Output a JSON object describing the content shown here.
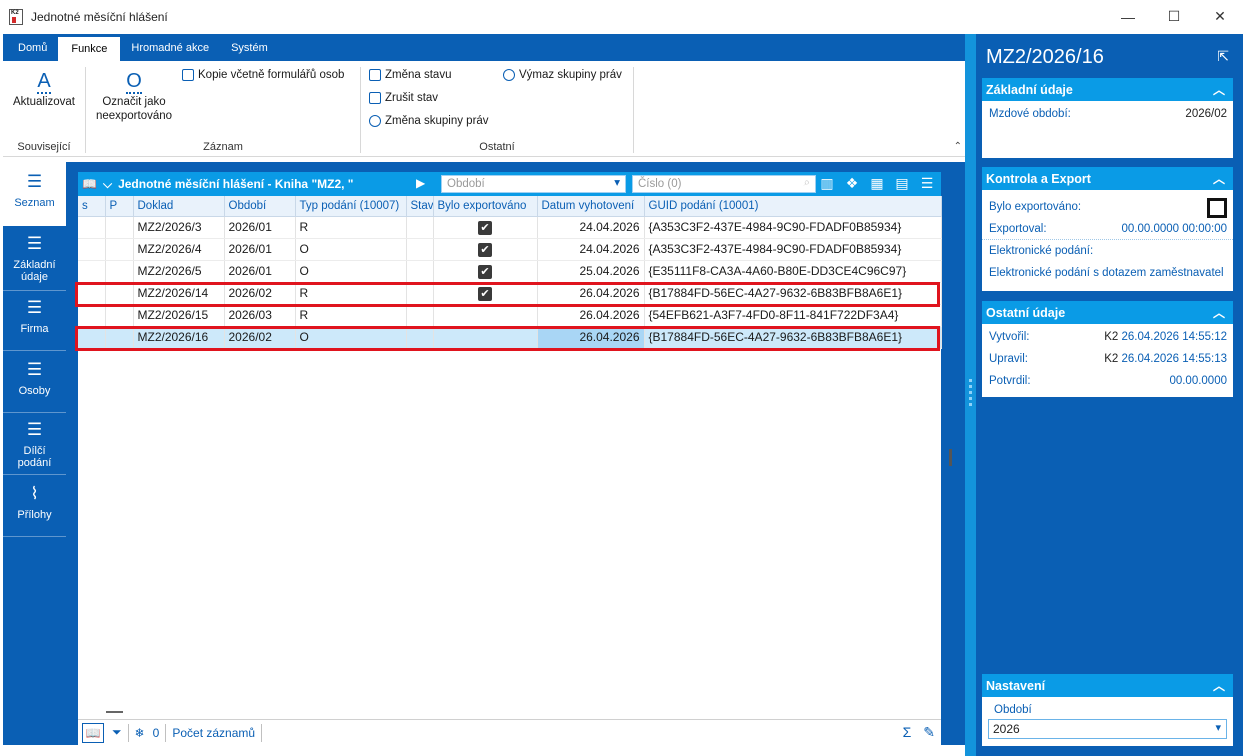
{
  "window": {
    "title": "Jednotné měsíční hlášení",
    "icon_text": "K2"
  },
  "ribbon": {
    "tabs": [
      "Domů",
      "Funkce",
      "Hromadné akce",
      "Systém"
    ],
    "active_tab": "Funkce",
    "groups": {
      "related": {
        "label": "Související",
        "refresh_label": "Aktualizovat"
      },
      "record": {
        "label": "Záznam",
        "mark_label_1": "Označit jako",
        "mark_label_2": "neexportováno",
        "copy_label": "Kopie včetně formulářů osob"
      },
      "other": {
        "label": "Ostatní",
        "change_state": "Změna stavu",
        "cancel_state": "Zrušit stav",
        "change_rights": "Změna skupiny práv",
        "delete_rights": "Výmaz skupiny práv"
      }
    }
  },
  "leftnav": {
    "items": [
      {
        "label": "Seznam"
      },
      {
        "label1": "Základní",
        "label2": "údaje"
      },
      {
        "label": "Firma"
      },
      {
        "label": "Osoby"
      },
      {
        "label1": "Dílčí",
        "label2": "podání"
      },
      {
        "label": "Přílohy"
      }
    ]
  },
  "grid": {
    "title": "Jednotné měsíční hlášení - Kniha \"MZ2, \"",
    "filter_period_placeholder": "Období",
    "filter_number_placeholder": "Číslo (0)",
    "columns": [
      "s",
      "P",
      "Doklad",
      "Období",
      "Typ podání (10007)",
      "Stav",
      "Bylo exportováno",
      "Datum vyhotovení",
      "GUID podání (10001)"
    ],
    "rows": [
      {
        "doklad": "MZ2/2026/3",
        "obdobi": "2026/01",
        "typ": "R",
        "exported": true,
        "datum": "24.04.2026",
        "guid": "{A353C3F2-437E-4984-9C90-FDADF0B85934}"
      },
      {
        "doklad": "MZ2/2026/4",
        "obdobi": "2026/01",
        "typ": "O",
        "exported": true,
        "datum": "24.04.2026",
        "guid": "{A353C3F2-437E-4984-9C90-FDADF0B85934}"
      },
      {
        "doklad": "MZ2/2026/5",
        "obdobi": "2026/01",
        "typ": "O",
        "exported": true,
        "datum": "25.04.2026",
        "guid": "{E35111F8-CA3A-4A60-B80E-DD3CE4C96C97}"
      },
      {
        "doklad": "MZ2/2026/14",
        "obdobi": "2026/02",
        "typ": "R",
        "exported": true,
        "datum": "26.04.2026",
        "guid": "{B17884FD-56EC-4A27-9632-6B83BFB8A6E1}"
      },
      {
        "doklad": "MZ2/2026/15",
        "obdobi": "2026/03",
        "typ": "R",
        "exported": false,
        "datum": "26.04.2026",
        "guid": "{54EFB621-A3F7-4FD0-8F11-841F722DF3A4}"
      },
      {
        "doklad": "MZ2/2026/16",
        "obdobi": "2026/02",
        "typ": "O",
        "exported": false,
        "datum": "26.04.2026",
        "guid": "{B17884FD-56EC-4A27-9632-6B83BFB8A6E1}"
      }
    ],
    "footer": {
      "count": "0",
      "record_count_label": "Počet záznamů"
    }
  },
  "right_panel": {
    "title": "MZ2/2026/16",
    "basic": {
      "header": "Základní údaje",
      "period_label": "Mzdové období:",
      "period_value": "2026/02"
    },
    "export": {
      "header": "Kontrola a Export",
      "exported_label": "Bylo exportováno:",
      "exported_by_label": "Exportoval:",
      "exported_by_value": "00.00.0000 00:00:00",
      "e_filing_label": "Elektronické podání:",
      "e_filing_query_label": "Elektronické podání s dotazem zaměstnavatel"
    },
    "other": {
      "header": "Ostatní údaje",
      "created_label": "Vytvořil:",
      "created_user": "K2",
      "created_value": "26.04.2026 14:55:12",
      "modified_label": "Upravil:",
      "modified_user": "K2",
      "modified_value": "26.04.2026 14:55:13",
      "confirmed_label": "Potvrdil:",
      "confirmed_value": "00.00.0000"
    },
    "settings": {
      "header": "Nastavení",
      "period_label": "Období",
      "period_value": "2026"
    }
  },
  "colors": {
    "primary": "#0a5fb4",
    "accent": "#0a9be6",
    "highlight_red": "#e0141e"
  }
}
